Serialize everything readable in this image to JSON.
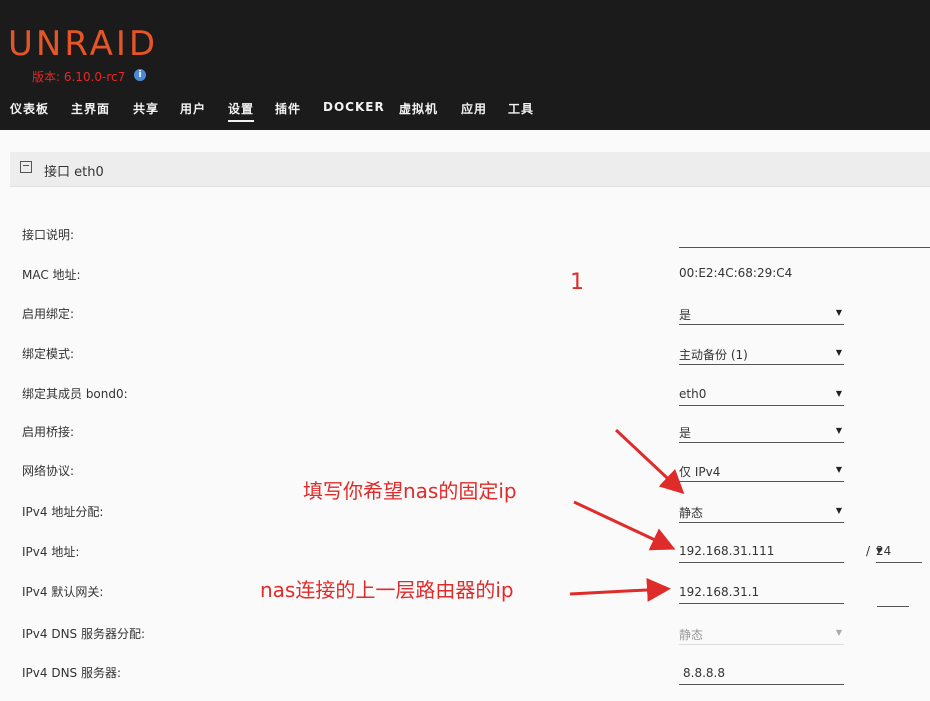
{
  "header": {
    "logo": "UNRAID",
    "version": "版本: 6.10.0-rc7",
    "info_icon": "info-icon"
  },
  "nav": {
    "items": [
      "仪表板",
      "主界面",
      "共享",
      "用户",
      "设置",
      "插件",
      "DOCKER",
      "虚拟机",
      "应用",
      "工具"
    ],
    "active": "设置"
  },
  "panel": {
    "icon": "network-interface-icon",
    "title": "接口 eth0"
  },
  "form": {
    "description_label": "接口说明:",
    "description_value": "",
    "mac_label": "MAC 地址:",
    "mac_value": "00:E2:4C:68:29:C4",
    "bonding_label": "启用绑定:",
    "bonding_value": "是",
    "bond_mode_label": "绑定模式:",
    "bond_mode_value": "主动备份 (1)",
    "bond_members_label": "绑定其成员 bond0:",
    "bond_members_value": "eth0",
    "bridging_label": "启用桥接:",
    "bridging_value": "是",
    "protocol_label": "网络协议:",
    "protocol_value": "仅 IPv4",
    "ipv4_assign_label": "IPv4 地址分配:",
    "ipv4_assign_value": "静态",
    "ipv4_addr_label": "IPv4 地址:",
    "ipv4_addr_value": "192.168.31.111",
    "ipv4_slash": "/",
    "ipv4_mask_value": "24",
    "gateway_label": "IPv4 默认网关:",
    "gateway_value": "192.168.31.1",
    "dns_assign_label": "IPv4 DNS 服务器分配:",
    "dns_assign_value": "静态",
    "dns_label": "IPv4 DNS 服务器:",
    "dns_value": "8.8.8.8"
  },
  "annotations": {
    "number": "1",
    "fixed_ip_note": "填写你希望nas的固定ip",
    "router_note": "nas连接的上一层路由器的ip",
    "color": "#e02b2b"
  },
  "colors": {
    "header_bg": "#1c1b1b",
    "logo": "#e55528",
    "version": "#e22828"
  }
}
